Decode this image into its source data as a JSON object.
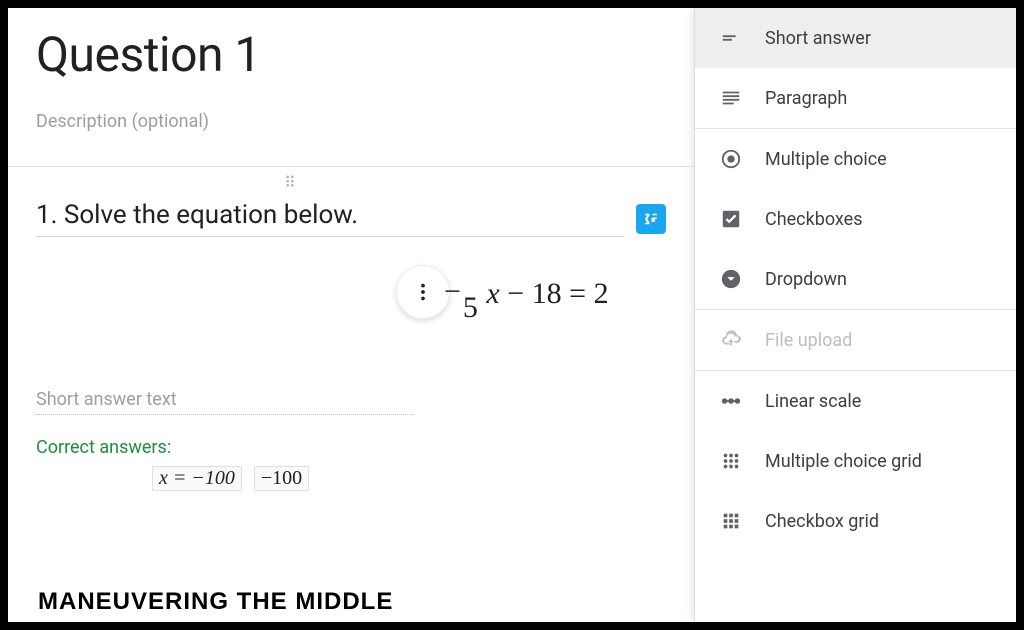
{
  "page": {
    "title": "Question 1",
    "description": "Description (optional)"
  },
  "question": {
    "text": "1. Solve the equation below.",
    "equation_display": "⁻⁄₅ x − 18 = 2"
  },
  "short_answer_placeholder": "Short answer text",
  "correct_answers": {
    "label": "Correct answers:",
    "values": [
      "x = −100",
      "−100"
    ]
  },
  "watermark": "MANEUVERING THE MIDDLE",
  "question_types": [
    {
      "key": "short-answer",
      "label": "Short answer",
      "selected": true
    },
    {
      "key": "paragraph",
      "label": "Paragraph"
    },
    {
      "key": "multiple-choice",
      "label": "Multiple choice"
    },
    {
      "key": "checkboxes",
      "label": "Checkboxes"
    },
    {
      "key": "dropdown",
      "label": "Dropdown"
    },
    {
      "key": "file-upload",
      "label": "File upload",
      "disabled": true
    },
    {
      "key": "linear-scale",
      "label": "Linear scale"
    },
    {
      "key": "multiple-choice-grid",
      "label": "Multiple choice grid"
    },
    {
      "key": "checkbox-grid",
      "label": "Checkbox grid"
    }
  ]
}
